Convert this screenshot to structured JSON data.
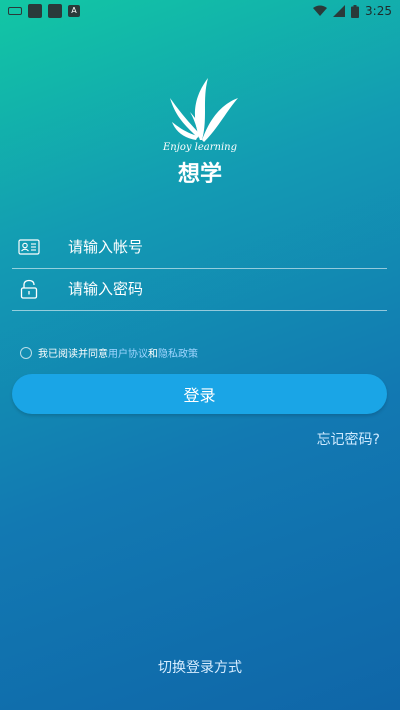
{
  "status_bar": {
    "time": "3:25",
    "left_icons": [
      "keyboard-icon",
      "app-icon",
      "app-icon",
      "a-icon"
    ],
    "right_icons": [
      "wifi-icon",
      "signal-icon",
      "battery-icon"
    ]
  },
  "logo": {
    "tagline": "Enjoy learning",
    "name": "想学"
  },
  "form": {
    "account_placeholder": "请输入帐号",
    "password_placeholder": "请输入密码"
  },
  "agreement": {
    "prefix": "我已阅读并同意",
    "user_agreement": "用户协议",
    "and": "和",
    "privacy_policy": "隐私政策"
  },
  "login_label": "登录",
  "forgot_password": "忘记密码?",
  "switch_login": "切换登录方式",
  "colors": {
    "gradient_top": "#12c7a4",
    "gradient_bottom": "#0f66a8",
    "button": "#1aa5e6",
    "link": "#9fd6ff"
  }
}
